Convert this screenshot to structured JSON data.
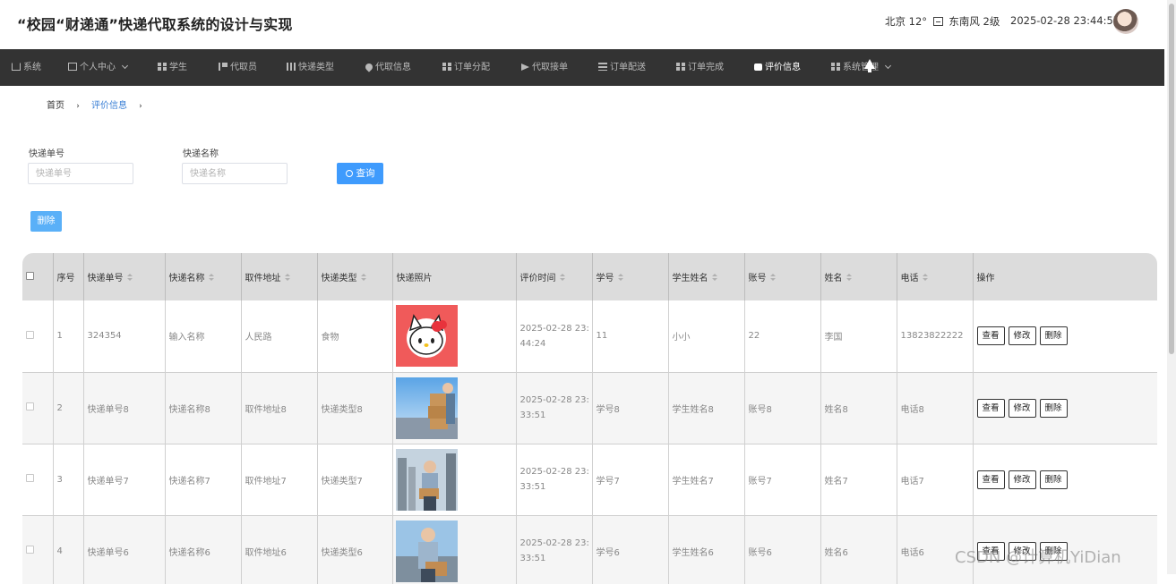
{
  "header": {
    "title": "“校园“财递通”快递代取系统的设计与实现",
    "weather": "北京 12° ",
    "weather_wind": " 东南风 2级",
    "datetime": "2025-02-28 23:44:57"
  },
  "nav": {
    "items": [
      {
        "label": "系统",
        "icon": "home-icon"
      },
      {
        "label": "个人中心",
        "icon": "user-box-icon"
      },
      {
        "label": "学生",
        "icon": "grid-icon"
      },
      {
        "label": "代取员",
        "icon": "flag-icon"
      },
      {
        "label": "快递类型",
        "icon": "bars-icon"
      },
      {
        "label": "代取信息",
        "icon": "pin-icon"
      },
      {
        "label": "订单分配",
        "icon": "grid-icon"
      },
      {
        "label": "代取接单",
        "icon": "send-icon"
      },
      {
        "label": "订单配送",
        "icon": "list-icon"
      },
      {
        "label": "订单完成",
        "icon": "grid-icon"
      },
      {
        "label": "评价信息",
        "icon": "thumb-icon"
      },
      {
        "label": "系统管理",
        "icon": "grid-icon"
      }
    ],
    "active": "评价信息"
  },
  "breadcrumb": {
    "home": "首页",
    "sep": "›",
    "current": "评价信息"
  },
  "search": {
    "tracking_label": "快递单号",
    "tracking_placeholder": "快递单号",
    "name_label": "快递名称",
    "name_placeholder": "快递名称",
    "query_label": "查询"
  },
  "toolbar": {
    "delete_label": "删除"
  },
  "table": {
    "columns": [
      "序号",
      "快递单号",
      "快递名称",
      "取件地址",
      "快递类型",
      "快递照片",
      "评价时间",
      "学号",
      "学生姓名",
      "账号",
      "姓名",
      "电话",
      "操作"
    ],
    "actions": {
      "view": "查看",
      "edit": "修改",
      "delete": "删除"
    },
    "rows": [
      {
        "index": "1",
        "tracking": "324354",
        "name": "输入名称",
        "address": "人民路",
        "type": "食物",
        "photo": "hello-kitty",
        "time": "2025-02-28 23:44:24",
        "student_no": "11",
        "student_name": "小小",
        "account": "22",
        "person": "李国",
        "phone": "13823822222"
      },
      {
        "index": "2",
        "tracking": "快递单号8",
        "name": "快递名称8",
        "address": "取件地址8",
        "type": "快递类型8",
        "photo": "courier-boxes",
        "time": "2025-02-28 23:33:51",
        "student_no": "学号8",
        "student_name": "学生姓名8",
        "account": "账号8",
        "person": "姓名8",
        "phone": "电话8"
      },
      {
        "index": "3",
        "tracking": "快递单号7",
        "name": "快递名称7",
        "address": "取件地址7",
        "type": "快递类型7",
        "photo": "courier-city",
        "time": "2025-02-28 23:33:51",
        "student_no": "学号7",
        "student_name": "学生姓名7",
        "account": "账号7",
        "person": "姓名7",
        "phone": "电话7"
      },
      {
        "index": "4",
        "tracking": "快递单号6",
        "name": "快递名称6",
        "address": "取件地址6",
        "type": "快递类型6",
        "photo": "courier-sky",
        "time": "2025-02-28 23:33:51",
        "student_no": "学号6",
        "student_name": "学生姓名6",
        "account": "账号6",
        "person": "姓名6",
        "phone": "电话6"
      }
    ]
  },
  "watermark": "CSDN @计算机YiDian"
}
